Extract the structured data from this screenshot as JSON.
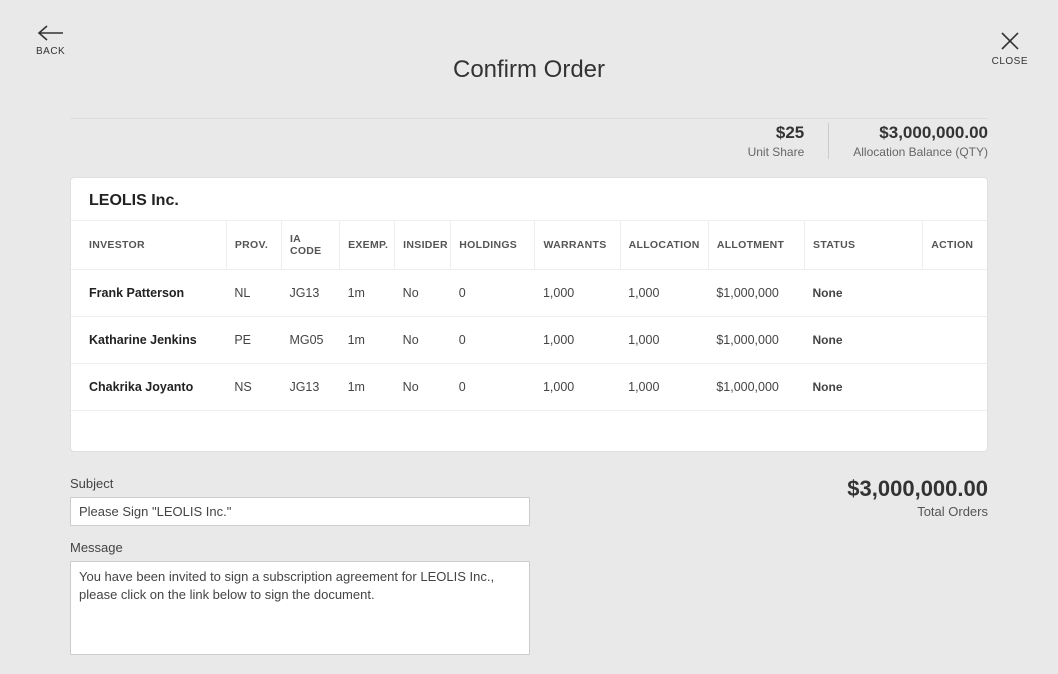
{
  "header": {
    "back_label": "BACK",
    "close_label": "CLOSE",
    "title": "Confirm Order"
  },
  "summary": {
    "unit_share": {
      "value": "$25",
      "label": "Unit Share"
    },
    "allocation_balance": {
      "value": "$3,000,000.00",
      "label": "Allocation Balance (QTY)"
    }
  },
  "card": {
    "company": "LEOLIS Inc."
  },
  "table": {
    "headers": {
      "investor": "INVESTOR",
      "prov": "PROV.",
      "ia_code": "IA CODE",
      "exemp": "EXEMP.",
      "insider": "INSIDER",
      "holdings": "HOLDINGS",
      "warrants": "WARRANTS",
      "allocation": "ALLOCATION",
      "allotment": "ALLOTMENT",
      "status": "STATUS",
      "action": "ACTION"
    },
    "rows": [
      {
        "investor": "Frank Patterson",
        "prov": "NL",
        "ia_code": "JG13",
        "exemp": "1m",
        "insider": "No",
        "holdings": "0",
        "warrants": "1,000",
        "allocation": "1,000",
        "allotment": "$1,000,000",
        "status": "None"
      },
      {
        "investor": "Katharine Jenkins",
        "prov": "PE",
        "ia_code": "MG05",
        "exemp": "1m",
        "insider": "No",
        "holdings": "0",
        "warrants": "1,000",
        "allocation": "1,000",
        "allotment": "$1,000,000",
        "status": "None"
      },
      {
        "investor": "Chakrika Joyanto",
        "prov": "NS",
        "ia_code": "JG13",
        "exemp": "1m",
        "insider": "No",
        "holdings": "0",
        "warrants": "1,000",
        "allocation": "1,000",
        "allotment": "$1,000,000",
        "status": "None"
      }
    ]
  },
  "form": {
    "subject_label": "Subject",
    "subject_value": "Please Sign \"LEOLIS Inc.\"",
    "message_label": "Message",
    "message_value": "You have been invited to sign a subscription agreement for LEOLIS Inc., please click on the link below to sign the document."
  },
  "totals": {
    "value": "$3,000,000.00",
    "label": "Total Orders"
  }
}
